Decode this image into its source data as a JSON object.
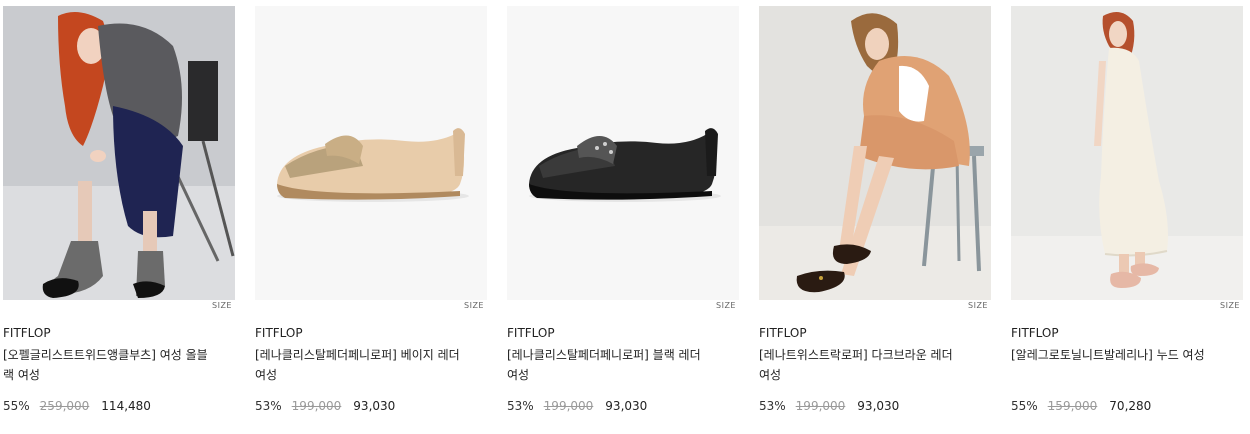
{
  "products": [
    {
      "brand": "FITFLOP",
      "title": "[오펠글리스트트위드앵클부츠] 여성 올블랙 여성",
      "size_tag": "SIZE",
      "discount": "55%",
      "original_price": "259,000",
      "sale_price": "114,480",
      "image": "woman-red-hair-tweed-ankle-boots"
    },
    {
      "brand": "FITFLOP",
      "title": "[레나클리스탈페더페니로퍼] 베이지 레더 여성",
      "size_tag": "SIZE",
      "discount": "53%",
      "original_price": "199,000",
      "sale_price": "93,030",
      "image": "beige-penny-loafer"
    },
    {
      "brand": "FITFLOP",
      "title": "[레나클리스탈페더페니로퍼] 블랙 레더 여성",
      "size_tag": "SIZE",
      "discount": "53%",
      "original_price": "199,000",
      "sale_price": "93,030",
      "image": "black-penny-loafer"
    },
    {
      "brand": "FITFLOP",
      "title": "[레나트위스트락로퍼] 다크브라운 레더 여성",
      "size_tag": "SIZE",
      "discount": "53%",
      "original_price": "199,000",
      "sale_price": "93,030",
      "image": "woman-tan-suit-brown-loafers"
    },
    {
      "brand": "FITFLOP",
      "title": "[알레그로토닐니트발레리나] 누드 여성",
      "size_tag": "SIZE",
      "discount": "55%",
      "original_price": "159,000",
      "sale_price": "70,280",
      "image": "woman-white-dress-nude-ballerina"
    }
  ],
  "colors": {
    "text": "#222222",
    "strike": "#9a9a9a",
    "image_bg_light": "#f7f7f7"
  }
}
